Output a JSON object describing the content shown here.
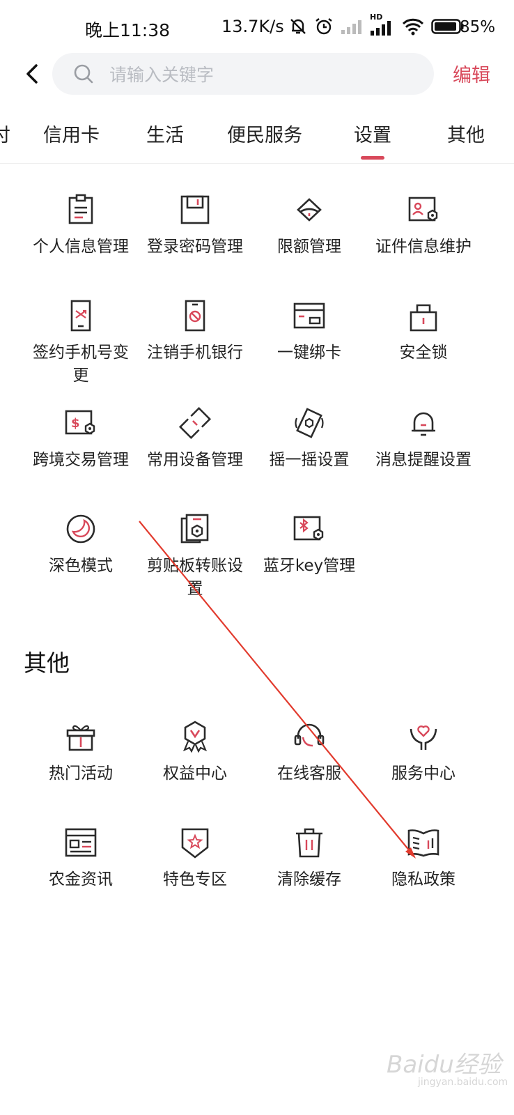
{
  "status_bar": {
    "time": "晚上11:38",
    "net_speed": "13.7K/s",
    "battery": "85%",
    "hd_badge": "HD",
    "icons": [
      "mute-icon",
      "alarm-icon",
      "signal-weak-icon",
      "signal-icon",
      "wifi-icon",
      "battery-icon"
    ]
  },
  "header": {
    "search_placeholder": "请输入关键字",
    "edit_label": "编辑"
  },
  "tabs": [
    {
      "label": "付"
    },
    {
      "label": "信用卡"
    },
    {
      "label": "生活"
    },
    {
      "label": "便民服务"
    },
    {
      "label": "设置",
      "active": true
    },
    {
      "label": "其他"
    }
  ],
  "settings_items": [
    {
      "label": "个人信息管理",
      "icon": "profile-doc-icon"
    },
    {
      "label": "登录密码管理",
      "icon": "floppy-icon"
    },
    {
      "label": "限额管理",
      "icon": "limit-icon"
    },
    {
      "label": "证件信息维护",
      "icon": "id-card-gear-icon"
    },
    {
      "label": "签约手机号变更",
      "icon": "phone-swap-icon"
    },
    {
      "label": "注销手机银行",
      "icon": "phone-cancel-icon"
    },
    {
      "label": "一键绑卡",
      "icon": "bind-card-icon"
    },
    {
      "label": "安全锁",
      "icon": "lock-icon"
    },
    {
      "label": "跨境交易管理",
      "icon": "dollar-gear-icon"
    },
    {
      "label": "常用设备管理",
      "icon": "device-icon"
    },
    {
      "label": "摇一摇设置",
      "icon": "shake-icon"
    },
    {
      "label": "消息提醒设置",
      "icon": "bell-icon"
    },
    {
      "label": "深色模式",
      "icon": "moon-icon"
    },
    {
      "label": "剪贴板转账设置",
      "icon": "clipboard-gear-icon"
    },
    {
      "label": "蓝牙key管理",
      "icon": "bluetooth-gear-icon"
    }
  ],
  "other_section": {
    "title": "其他",
    "items": [
      {
        "label": "热门活动",
        "icon": "gift-icon"
      },
      {
        "label": "权益中心",
        "icon": "medal-icon"
      },
      {
        "label": "在线客服",
        "icon": "headset-icon"
      },
      {
        "label": "服务中心",
        "icon": "heart-hand-icon"
      },
      {
        "label": "农金资讯",
        "icon": "news-icon"
      },
      {
        "label": "特色专区",
        "icon": "star-shield-icon"
      },
      {
        "label": "清除缓存",
        "icon": "trash-icon"
      },
      {
        "label": "隐私政策",
        "icon": "book-icon"
      }
    ]
  },
  "watermark": {
    "brand": "Baidu经验",
    "url": "jingyan.baidu.com"
  },
  "colors": {
    "accent": "#d8485a",
    "icon_stroke": "#2b2b2b",
    "annotation_arrow": "#e23b2e"
  }
}
